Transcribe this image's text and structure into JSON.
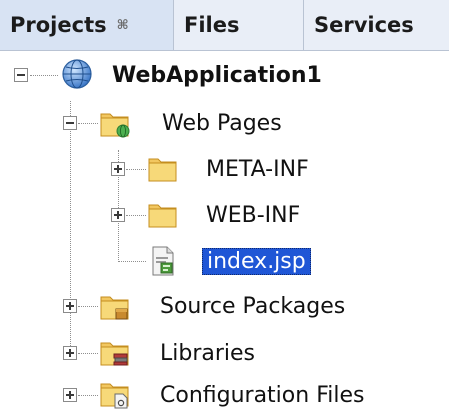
{
  "tabs": [
    {
      "label": "Projects",
      "close_glyph": "⌘"
    },
    {
      "label": "Files"
    },
    {
      "label": "Services"
    }
  ],
  "tree": {
    "project": "WebApplication1",
    "web_pages": "Web Pages",
    "meta_inf": "META-INF",
    "web_inf": "WEB-INF",
    "index": "index.jsp",
    "source_packages": "Source Packages",
    "libraries": "Libraries",
    "config_files": "Configuration Files"
  },
  "colors": {
    "selection": "#1f56d6",
    "tab_bg": "#d8e3f3"
  }
}
